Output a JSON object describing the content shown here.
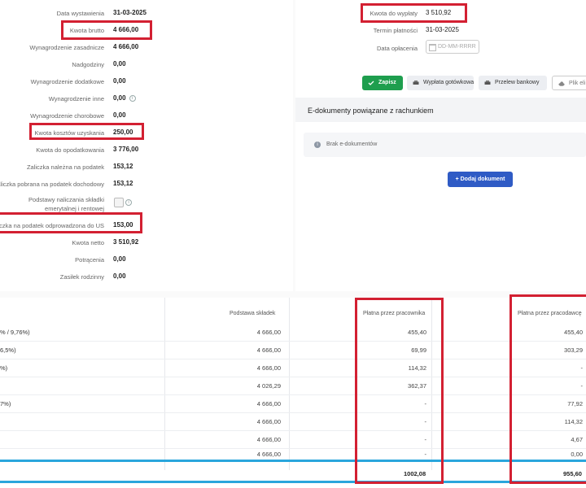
{
  "form": {
    "rows": [
      {
        "label": "Data wystawienia",
        "value": "31-03-2025"
      },
      {
        "label": "Kwota brutto",
        "value": "4 666,00"
      },
      {
        "label": "Wynagrodzenie zasadnicze",
        "value": "4 666,00"
      },
      {
        "label": "Nadgodziny",
        "value": "0,00"
      },
      {
        "label": "Wynagrodzenie dodatkowe",
        "value": "0,00"
      },
      {
        "label": "Wynagrodzenie inne",
        "value": "0,00"
      },
      {
        "label": "Wynagrodzenie chorobowe",
        "value": "0,00"
      },
      {
        "label": "Kwota kosztów uzyskania",
        "value": "250,00"
      },
      {
        "label": "Kwota do opodatkowania",
        "value": "3 776,00"
      },
      {
        "label": "Zaliczka należna na podatek",
        "value": "153,12"
      },
      {
        "label": "Zaliczka pobrana na podatek dochodowy",
        "value": "153,12"
      },
      {
        "label": "Podstawy naliczania składki emerytalnej i rentowej",
        "value": ""
      },
      {
        "label": "Zaliczka na podatek odprowadzona do US",
        "value": "153,00"
      },
      {
        "label": "Kwota netto",
        "value": "3 510,92"
      },
      {
        "label": "Potrącenia",
        "value": "0,00"
      },
      {
        "label": "Zasiłek rodzinny",
        "value": "0,00"
      }
    ]
  },
  "payment": {
    "amount_label": "Kwota do wypłaty",
    "amount_value": "3 510,92",
    "due_label": "Termin płatności",
    "due_value": "31-03-2025",
    "paid_label": "Data opłacenia",
    "paid_placeholder": "DD-MM-RRRR"
  },
  "buttons": {
    "save": "Zapisz",
    "cash": "Wypłata gotówkowa",
    "bank": "Przelew bankowy",
    "file": "Plik eli"
  },
  "edocs": {
    "title": "E-dokumenty powiązane z rachunkiem",
    "empty": "Brak e-dokumentów",
    "add_button": "+ Dodaj dokument"
  },
  "table": {
    "headers": {
      "base": "Podstawa składek",
      "employee": "Płatna przez pracownika",
      "employer": "Płatna przez pracodawcę"
    },
    "rows": [
      {
        "name": "% / 9,76%)",
        "base": "4 666,00",
        "employee": "455,40",
        "employer": "455,40"
      },
      {
        "name": "6,5%)",
        "base": "4 666,00",
        "employee": "69,99",
        "employer": "303,29"
      },
      {
        "name": "%)",
        "base": "4 666,00",
        "employee": "114,32",
        "employer": "-"
      },
      {
        "name": "",
        "base": "4 026,29",
        "employee": "362,37",
        "employer": "-"
      },
      {
        "name": "7%)",
        "base": "4 666,00",
        "employee": "-",
        "employer": "77,92"
      },
      {
        "name": "",
        "base": "4 666,00",
        "employee": "-",
        "employer": "114,32"
      },
      {
        "name": "",
        "base": "4 666,00",
        "employee": "-",
        "employer": "4,67"
      },
      {
        "name": "",
        "base": "4 666,00",
        "employee": "-",
        "employer": "0,00"
      }
    ],
    "total_employee": "1002,08",
    "total_employer": "955,60"
  },
  "colors": {
    "highlight_red": "#d32032",
    "highlight_blue": "#2aa6dc",
    "save_green": "#1e9e4e",
    "add_blue": "#2f5bc5"
  }
}
